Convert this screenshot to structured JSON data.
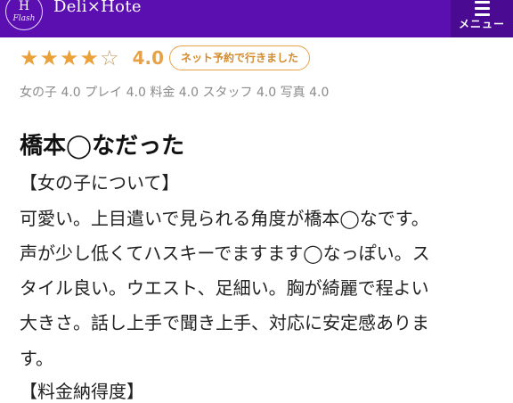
{
  "header": {
    "logo_letter": "H",
    "logo_script": "Flash",
    "site_title": "Deli×Hote",
    "menu_label": "メニュー",
    "bg_color": "#5b0fb0"
  },
  "rating": {
    "stars": 4,
    "max_stars": 5,
    "score": "4.0",
    "badge": "ネット予約で行きました",
    "accent_color": "#eba13a"
  },
  "subscores": {
    "text": "女の子 4.0 プレイ 4.0 料金 4.0 スタッフ 4.0 写真 4.0"
  },
  "review": {
    "title": "橋本◯なだった",
    "lines": [
      "【女の子について】",
      "可愛い。上目遣いで見られる角度が橋本◯なです。",
      "声が少し低くてハスキーでますます◯なっぽい。ス",
      "タイル良い。ウエスト、足細い。胸が綺麗で程よい",
      "大きさ。話し上手で聞き上手、対応に安定感ありま",
      "す。",
      "【料金納得度】"
    ]
  }
}
